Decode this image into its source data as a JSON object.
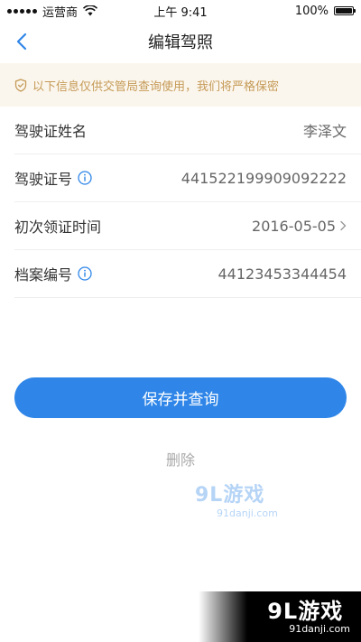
{
  "status_bar": {
    "carrier": "运营商",
    "time": "上午 9:41",
    "battery": "100%"
  },
  "nav": {
    "title": "编辑驾照"
  },
  "notice": {
    "text": "以下信息仅供交管局查询使用，我们将严格保密"
  },
  "form": {
    "rows": [
      {
        "label": "驾驶证姓名",
        "value": "李泽文"
      },
      {
        "label": "驾驶证号",
        "value": "441522199909092222"
      },
      {
        "label": "初次领证时间",
        "value": "2016-05-05"
      },
      {
        "label": "档案编号",
        "value": "44123453344454"
      }
    ]
  },
  "actions": {
    "save_label": "保存并查询",
    "delete_label": "删除"
  },
  "watermark": {
    "brand": "9L游戏",
    "site": "91danji.com"
  },
  "colors": {
    "accent": "#2f86e8",
    "notice_bg": "#fbf6ed",
    "notice_text": "#c59a57"
  }
}
